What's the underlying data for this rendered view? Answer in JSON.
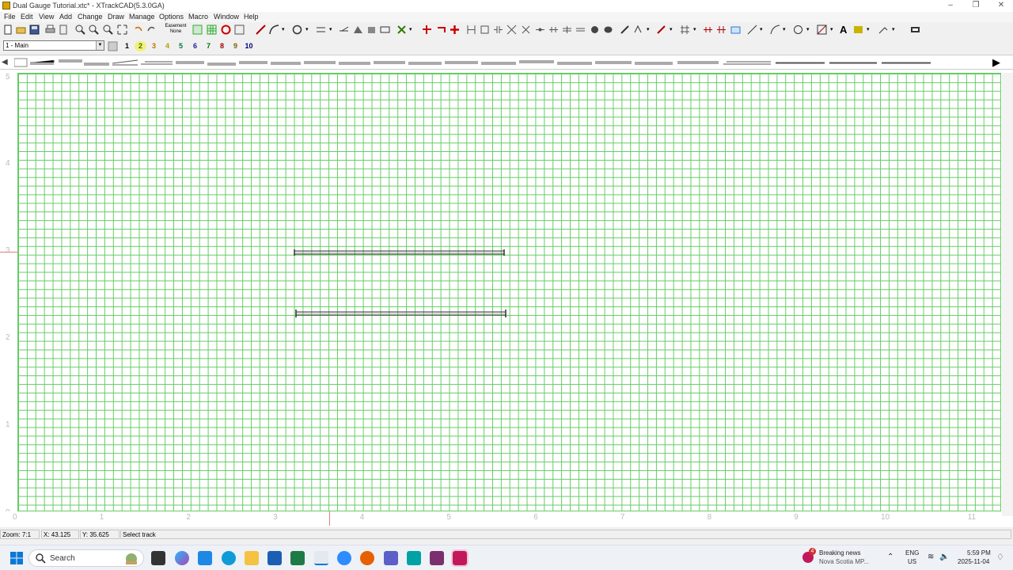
{
  "window": {
    "title": "Dual Gauge Tutorial.xtc* - XTrackCAD(5.3.0GA)",
    "controls": [
      "minimize",
      "restore",
      "close"
    ]
  },
  "menubar": [
    "File",
    "Edit",
    "View",
    "Add",
    "Change",
    "Draw",
    "Manage",
    "Options",
    "Macro",
    "Window",
    "Help"
  ],
  "toolbar": {
    "easement_label": "Easement",
    "easement_value": "None"
  },
  "layers": {
    "current": "1 - Main",
    "buttons": [
      "1",
      "2",
      "3",
      "4",
      "5",
      "6",
      "7",
      "8",
      "9",
      "10"
    ],
    "colors": [
      "#000000",
      "#2a7a00",
      "#c07000",
      "#b0a000",
      "#007a40",
      "#1f1fa0",
      "#007000",
      "#a00000",
      "#806000",
      "#000080"
    ]
  },
  "rulers": {
    "vertical": [
      "5",
      "4",
      "3",
      "2",
      "1",
      "0"
    ],
    "horizontal": [
      "0",
      "1",
      "2",
      "3",
      "4",
      "5",
      "6",
      "7",
      "8",
      "9",
      "10",
      "11"
    ]
  },
  "status": {
    "zoom": "Zoom: 7:1",
    "x": "X: 43.125",
    "y": "Y: 35.625",
    "message": "Select track"
  },
  "taskbar": {
    "search_placeholder": "Search",
    "news_badge": "4",
    "news_title": "Breaking news",
    "news_sub": "Nova Scotia MP...",
    "lang": "ENG",
    "region": "US",
    "time": "5:59 PM",
    "date": "2025-11-04"
  },
  "colors": {
    "grid": "#66cc66",
    "track": "#333333"
  }
}
